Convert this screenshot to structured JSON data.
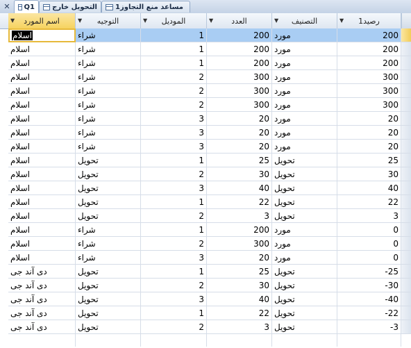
{
  "tabs": [
    {
      "label": "Q1",
      "active": true
    },
    {
      "label": "التحويل خارج",
      "active": false
    },
    {
      "label": "مساعد منع التجاوز1",
      "active": false
    }
  ],
  "columns": [
    {
      "label": "اسم المورد",
      "selected": true
    },
    {
      "label": "التوجيه"
    },
    {
      "label": "الموديل"
    },
    {
      "label": "العدد"
    },
    {
      "label": "التصنيف"
    },
    {
      "label": "رصيد1"
    }
  ],
  "rows": [
    [
      "اسلام",
      "شراء",
      "1",
      "200",
      "مورد",
      "200"
    ],
    [
      "اسلام",
      "شراء",
      "1",
      "200",
      "مورد",
      "200"
    ],
    [
      "اسلام",
      "شراء",
      "1",
      "200",
      "مورد",
      "200"
    ],
    [
      "اسلام",
      "شراء",
      "2",
      "300",
      "مورد",
      "300"
    ],
    [
      "اسلام",
      "شراء",
      "2",
      "300",
      "مورد",
      "300"
    ],
    [
      "اسلام",
      "شراء",
      "2",
      "300",
      "مورد",
      "300"
    ],
    [
      "اسلام",
      "شراء",
      "3",
      "20",
      "مورد",
      "20"
    ],
    [
      "اسلام",
      "شراء",
      "3",
      "20",
      "مورد",
      "20"
    ],
    [
      "اسلام",
      "شراء",
      "3",
      "20",
      "مورد",
      "20"
    ],
    [
      "اسلام",
      "تحويل",
      "1",
      "25",
      "تحويل",
      "25"
    ],
    [
      "اسلام",
      "تحويل",
      "2",
      "30",
      "تحويل",
      "30"
    ],
    [
      "اسلام",
      "تحويل",
      "3",
      "40",
      "تحويل",
      "40"
    ],
    [
      "اسلام",
      "تحويل",
      "1",
      "22",
      "تحويل",
      "22"
    ],
    [
      "اسلام",
      "تحويل",
      "2",
      "3",
      "تحويل",
      "3"
    ],
    [
      "اسلام",
      "شراء",
      "1",
      "200",
      "مورد",
      "0"
    ],
    [
      "اسلام",
      "شراء",
      "2",
      "300",
      "مورد",
      "0"
    ],
    [
      "اسلام",
      "شراء",
      "3",
      "20",
      "مورد",
      "0"
    ],
    [
      "دى آند جى",
      "تحويل",
      "1",
      "25",
      "تحويل",
      "-25"
    ],
    [
      "دى آند جى",
      "تحويل",
      "2",
      "30",
      "تحويل",
      "-30"
    ],
    [
      "دى آند جى",
      "تحويل",
      "3",
      "40",
      "تحويل",
      "-40"
    ],
    [
      "دى آند جى",
      "تحويل",
      "1",
      "22",
      "تحويل",
      "-22"
    ],
    [
      "دى آند جى",
      "تحويل",
      "2",
      "3",
      "تحويل",
      "-3"
    ]
  ],
  "selected_row": 0
}
